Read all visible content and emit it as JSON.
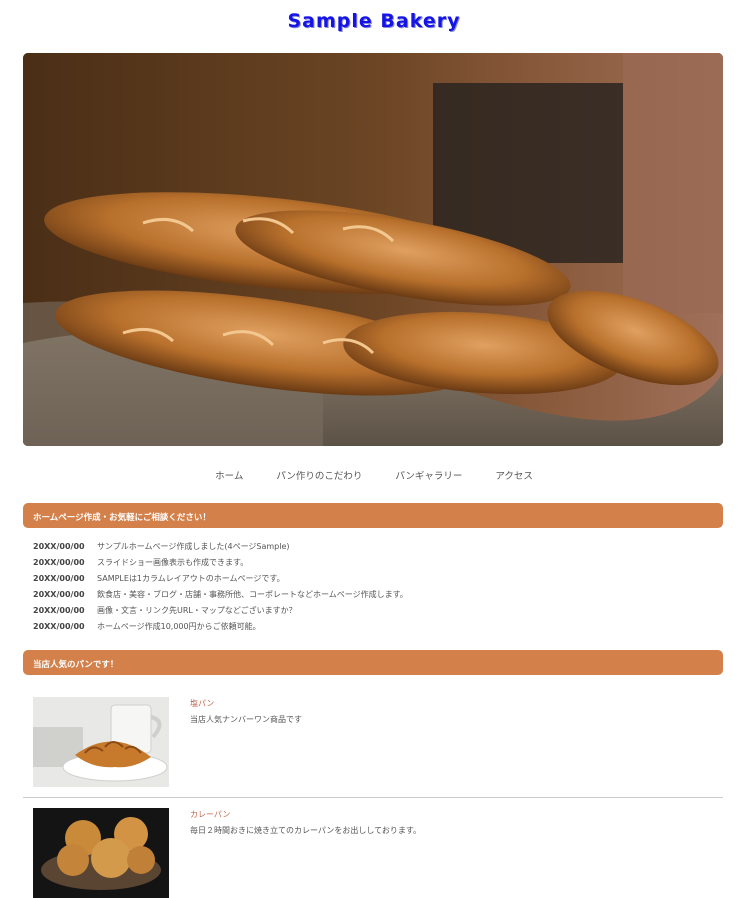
{
  "header": {
    "site_title": "Sample Bakery"
  },
  "nav": {
    "items": [
      {
        "label": "ホーム"
      },
      {
        "label": "パン作りのこだわり"
      },
      {
        "label": "パンギャラリー"
      },
      {
        "label": "アクセス"
      }
    ]
  },
  "news": {
    "heading": "ホームページ作成・お気軽にご相談ください！",
    "items": [
      {
        "date": "20XX/00/00",
        "text": "サンプルホームページ作成しました(4ページSample)"
      },
      {
        "date": "20XX/00/00",
        "text": "スライドショー画像表示も作成できます。"
      },
      {
        "date": "20XX/00/00",
        "text": "SAMPLEは1カラムレイアウトのホームページです。"
      },
      {
        "date": "20XX/00/00",
        "text": "飲食店・美容・ブログ・店舗・事務所他、コーポレートなどホームページ作成します。"
      },
      {
        "date": "20XX/00/00",
        "text": "画像・文言・リンク先URL・マップなどございますか？"
      },
      {
        "date": "20XX/00/00",
        "text": "ホームページ作成10,000円からご依頼可能。"
      }
    ]
  },
  "popular": {
    "heading": "当店人気のパンです！",
    "products": [
      {
        "name": "塩パン",
        "description": "当店人気ナンバーワン商品です"
      },
      {
        "name": "カレーパン",
        "description": "毎日２時間おきに焼き立てのカレーパンをお出ししております。"
      }
    ]
  },
  "colors": {
    "title": "#1414e6",
    "accent_bar": "#d3804a",
    "product_name": "#c06a50"
  }
}
